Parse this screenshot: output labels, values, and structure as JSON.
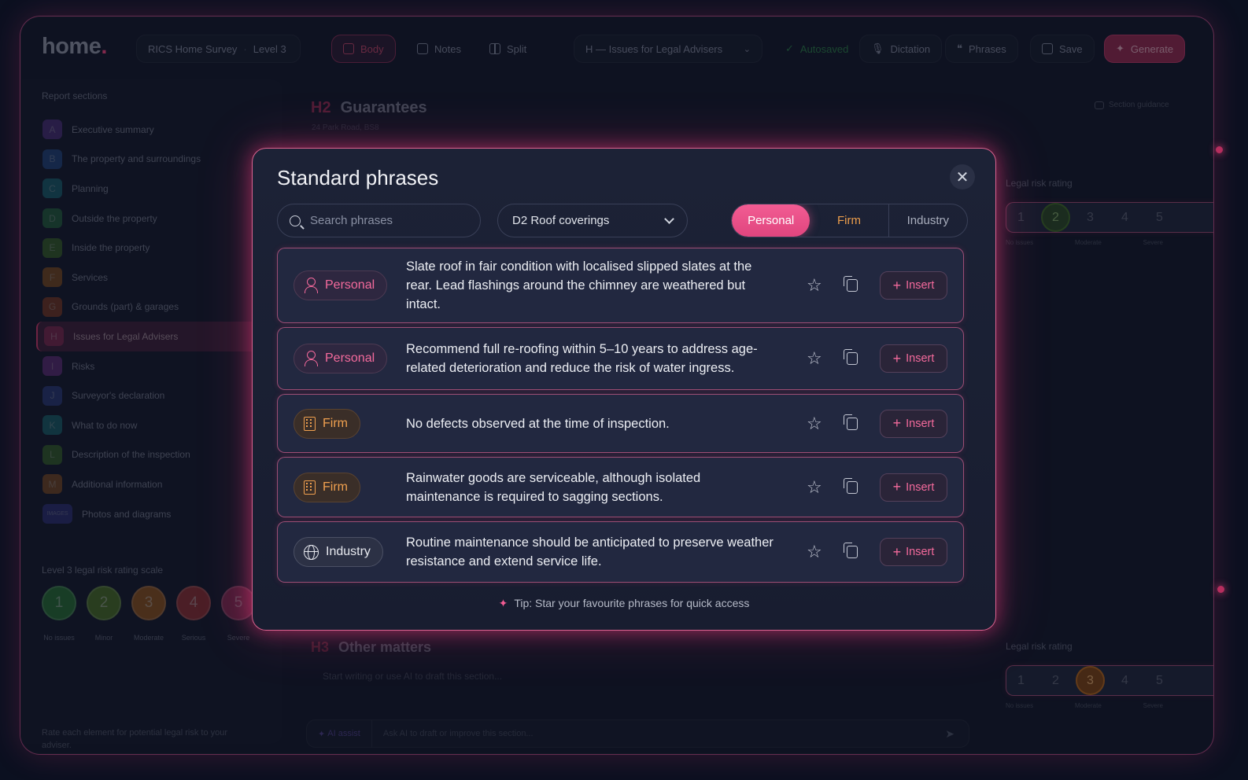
{
  "app": {
    "logo": "home",
    "logo_dot": ".",
    "survey": "RICS Home Survey",
    "level": "Level 3",
    "tabs": {
      "body": "Body",
      "notes": "Notes",
      "split": "Split"
    },
    "section_select": "H — Issues for Legal Advisers",
    "autosaved": "Autosaved",
    "dictation": "Dictation",
    "phrases": "Phrases",
    "save": "Save",
    "generate": "Generate"
  },
  "sidebar": {
    "title": "Report sections",
    "items": [
      {
        "code": "A",
        "label": "Executive summary",
        "color": "#6b3fa8"
      },
      {
        "code": "B",
        "label": "The property and surroundings",
        "color": "#2b5fb0"
      },
      {
        "code": "C",
        "label": "Planning",
        "color": "#1f8a97"
      },
      {
        "code": "D",
        "label": "Outside the property",
        "color": "#2f8a4c"
      },
      {
        "code": "E",
        "label": "Inside the property",
        "color": "#4e8a2c"
      },
      {
        "code": "F",
        "label": "Services",
        "color": "#b56a1e"
      },
      {
        "code": "G",
        "label": "Grounds (part) & garages",
        "color": "#b24d22"
      },
      {
        "code": "H",
        "label": "Issues for Legal Advisers",
        "color": "#a3305f"
      },
      {
        "code": "I",
        "label": "Risks",
        "color": "#8a3aa3"
      },
      {
        "code": "J",
        "label": "Surveyor's declaration",
        "color": "#3a4fa8"
      },
      {
        "code": "K",
        "label": "What to do now",
        "color": "#1e8a8f"
      },
      {
        "code": "L",
        "label": "Description of the inspection",
        "color": "#4a8a2e"
      },
      {
        "code": "M",
        "label": "Additional information",
        "color": "#b06622"
      },
      {
        "code": "IMAGES",
        "label": "Photos and diagrams",
        "color": "#3b3fa0"
      }
    ],
    "scale_title": "Level 3 legal risk rating scale",
    "scale": [
      {
        "n": "1",
        "label": "No issues",
        "color": "#2f8a3c"
      },
      {
        "n": "2",
        "label": "Minor",
        "color": "#5a8a2a"
      },
      {
        "n": "3",
        "label": "Moderate",
        "color": "#b0651f"
      },
      {
        "n": "4",
        "label": "Serious",
        "color": "#b23a3a"
      },
      {
        "n": "5",
        "label": "Severe",
        "color": "#a3305f"
      }
    ],
    "note": "Rate each element for potential legal risk to your adviser."
  },
  "main": {
    "h2_code": "H2",
    "h2_title": "Guarantees",
    "address": "24 Park Road, BS8",
    "guidance": "Section guidance",
    "risk_title": "Legal risk rating",
    "risk_numbers": [
      "1",
      "2",
      "3",
      "4",
      "5"
    ],
    "risk_caps": [
      "No issues",
      "Moderate",
      "Severe"
    ],
    "h3_code": "H3",
    "h3_title": "Other matters",
    "editor_placeholder": "Start writing or use AI to draft this section...",
    "ai_assist": "AI assist",
    "ai_prompt": "Ask AI to draft or improve this section..."
  },
  "modal": {
    "title": "Standard phrases",
    "search_placeholder": "Search phrases",
    "category": "D2 Roof coverings",
    "filters": {
      "personal": "Personal",
      "firm": "Firm",
      "industry": "Industry"
    },
    "phrases": [
      {
        "tag": "Personal",
        "text": "Slate roof in fair condition with localised slipped slates at the rear. Lead flashings around the chimney are weathered but intact.",
        "insert": "Insert"
      },
      {
        "tag": "Personal",
        "text": "Recommend full re-roofing within 5–10 years to address age-related deterioration and reduce the risk of water ingress.",
        "insert": "Insert"
      },
      {
        "tag": "Firm",
        "text": "No defects observed at the time of inspection.",
        "insert": "Insert"
      },
      {
        "tag": "Firm",
        "text": "Rainwater goods are serviceable, although isolated maintenance is required to sagging sections.",
        "insert": "Insert"
      },
      {
        "tag": "Industry",
        "text": "Routine maintenance should be anticipated to preserve weather resistance and extend service life.",
        "insert": "Insert"
      }
    ],
    "tip": "Tip: Star your favourite phrases for quick access"
  }
}
